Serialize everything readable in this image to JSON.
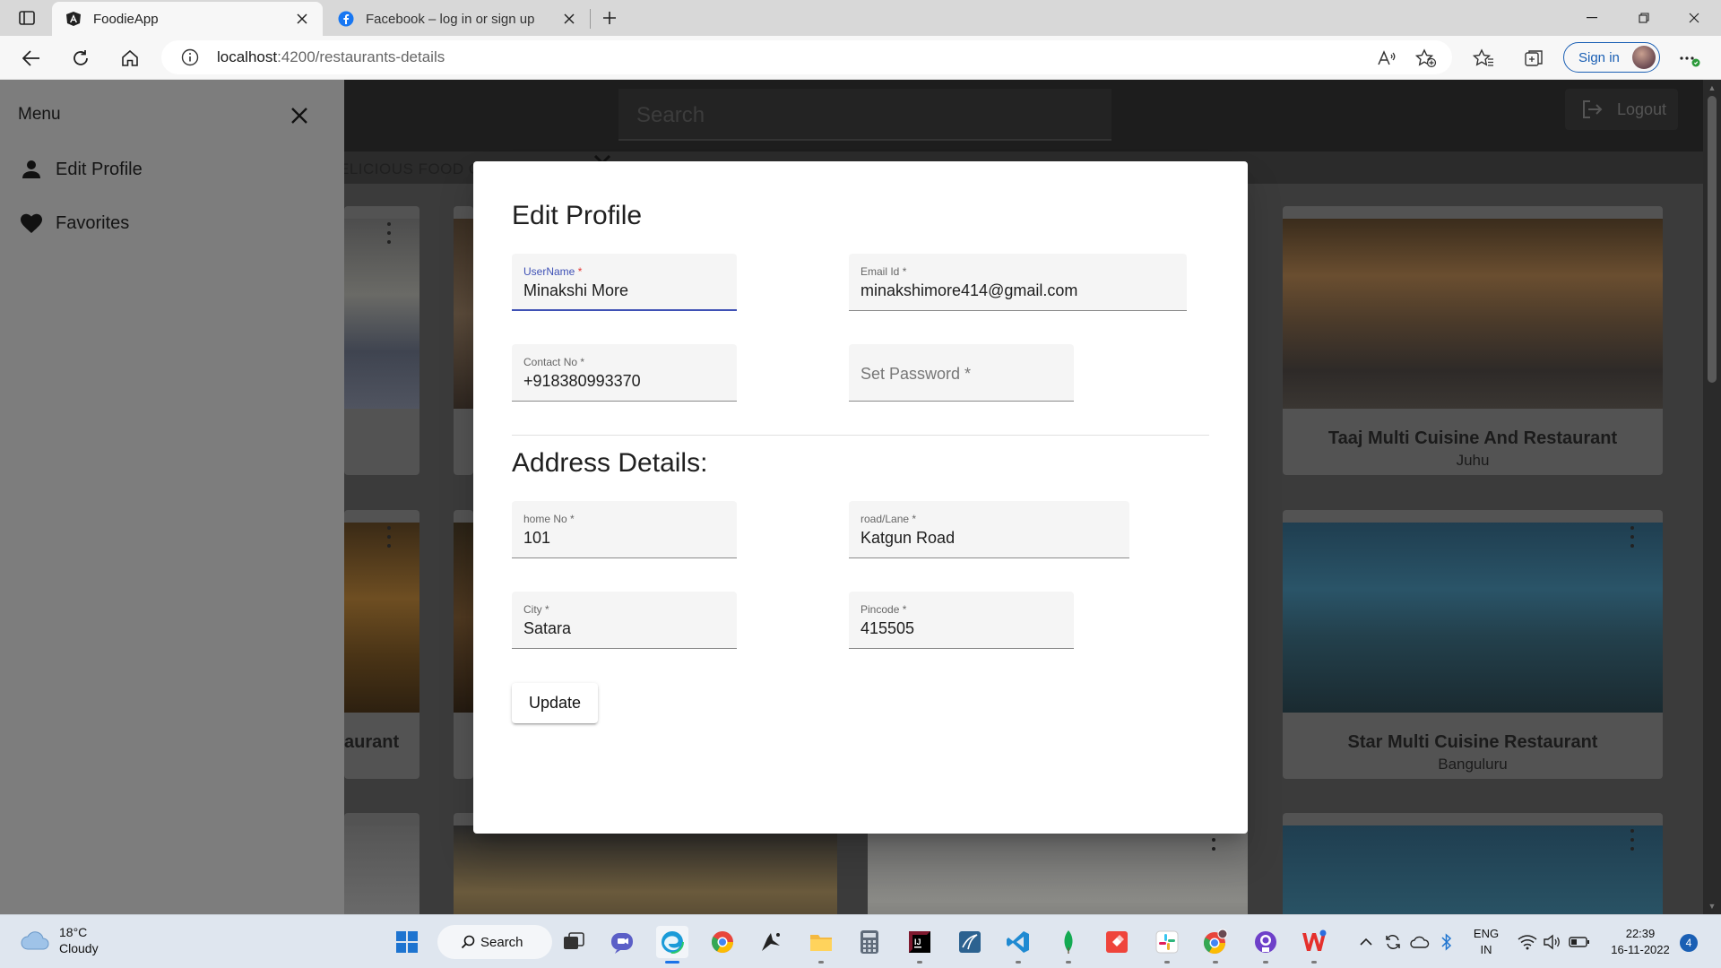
{
  "browser": {
    "tabs": [
      {
        "label": "FoodieApp",
        "active": true
      },
      {
        "label": "Facebook – log in or sign up",
        "active": false
      }
    ],
    "url_host": "localhost",
    "url_path": ":4200/restaurants-details",
    "signin_label": "Sign in"
  },
  "app": {
    "search_placeholder": "Search",
    "logout_label": "Logout",
    "marquee": "ELICIOUS FOOD ONL",
    "cards": [
      {
        "title": "Taaj Multi Cuisine And Restaurant",
        "subtitle": "Juhu"
      },
      {
        "title": "Star Multi Cuisine Restaurant",
        "subtitle": "Banguluru"
      },
      {
        "title": "aurant",
        "subtitle": ""
      }
    ]
  },
  "drawer": {
    "title": "Menu",
    "items": [
      {
        "label": "Edit Profile",
        "icon": "person-icon"
      },
      {
        "label": "Favorites",
        "icon": "heart-icon"
      }
    ]
  },
  "modal": {
    "title": "Edit Profile",
    "section_title": "Address Details:",
    "fields": {
      "username": {
        "label": "UserName",
        "value": "Minakshi More"
      },
      "email": {
        "label": "Email Id",
        "value": "minakshimore414@gmail.com"
      },
      "contact": {
        "label": "Contact No",
        "value": "+918380993370"
      },
      "password": {
        "placeholder": "Set Password *"
      },
      "home_no": {
        "label": "home No",
        "value": "101"
      },
      "road": {
        "label": "road/Lane",
        "value": "Katgun Road"
      },
      "city": {
        "label": "City",
        "value": "Satara"
      },
      "pincode": {
        "label": "Pincode",
        "value": "415505"
      }
    },
    "required_mark": "*",
    "update_label": "Update"
  },
  "taskbar": {
    "weather_temp": "18°C",
    "weather_desc": "Cloudy",
    "search_label": "Search",
    "lang_line1": "ENG",
    "lang_line2": "IN",
    "time": "22:39",
    "date": "16-11-2022",
    "notifications": "4"
  },
  "colors": {
    "accent": "#3f51b5",
    "required": "#e53935",
    "edge_blue": "#1a5fb4"
  }
}
